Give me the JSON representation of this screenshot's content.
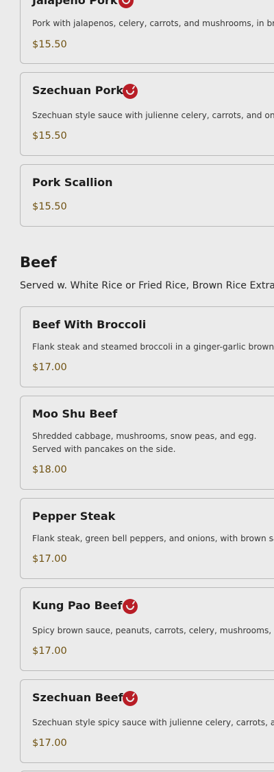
{
  "colors": {
    "price": "#7a5a14",
    "spicy_badge": "#c8202a",
    "border": "#c9c9c9"
  },
  "pork_items": [
    {
      "name": "Jalapeño Pork",
      "spicy": true,
      "description": "Pork with jalapenos, celery, carrots, and mushrooms, in brown sauce.",
      "price": "$15.50"
    },
    {
      "name": "Szechuan Pork",
      "spicy": true,
      "description": "Szechuan style sauce with julienne celery, carrots, and onions.",
      "price": "$15.50"
    },
    {
      "name": "Pork Scallion",
      "spicy": false,
      "description": "",
      "price": "$15.50"
    }
  ],
  "beef": {
    "title": "Beef",
    "note": "Served w. White Rice or Fried Rice, Brown Rice Extra",
    "items": [
      {
        "name": "Beef With Broccoli",
        "spicy": false,
        "description": "Flank steak and steamed broccoli in a ginger-garlic brown sauce.",
        "price": "$17.00"
      },
      {
        "name": "Moo Shu Beef",
        "spicy": false,
        "description": "Shredded cabbage, mushrooms, snow peas, and egg. Served with pancakes on the side.",
        "price": "$18.00"
      },
      {
        "name": "Pepper Steak",
        "spicy": false,
        "description": "Flank steak, green bell peppers, and onions, with brown sauce.",
        "price": "$17.00"
      },
      {
        "name": "Kung Pao Beef",
        "spicy": true,
        "description": "Spicy brown sauce, peanuts, carrots, celery, mushrooms, and onions.",
        "price": "$17.00"
      },
      {
        "name": "Szechuan Beef",
        "spicy": true,
        "description": "Szechuan style spicy sauce with julienne celery, carrots, and onions.",
        "price": "$17.00"
      }
    ]
  }
}
